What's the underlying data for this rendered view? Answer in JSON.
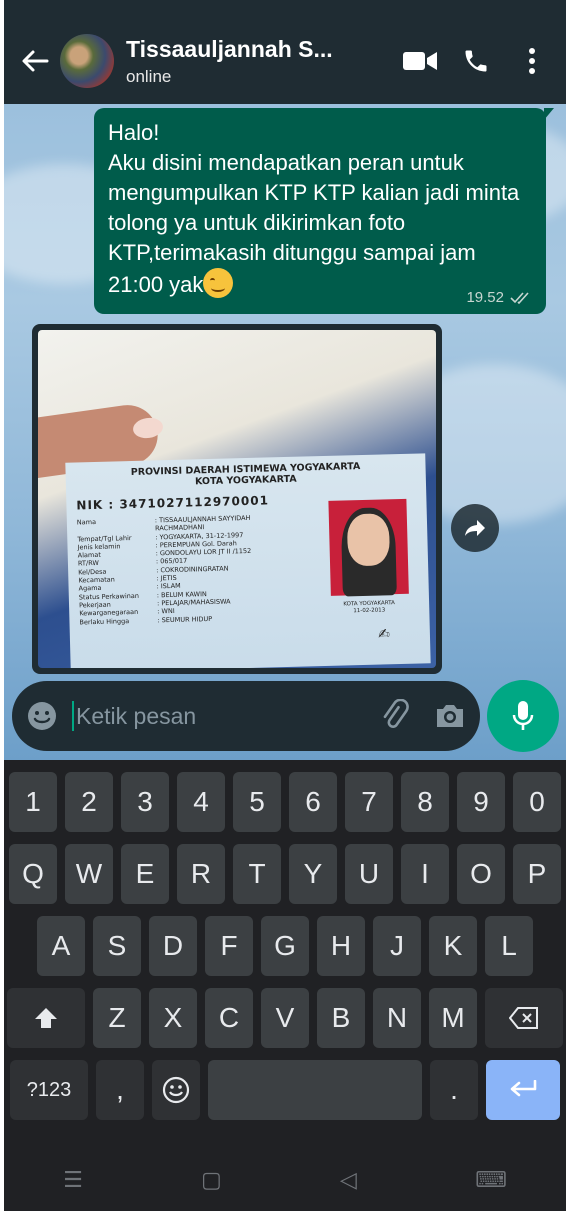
{
  "header": {
    "contact_name": "Tissaauljannah S...",
    "status": "online"
  },
  "messages": {
    "outgoing_text": "Halo!\nAku disini mendapatkan peran untuk mengumpulkan KTP KTP kalian jadi minta tolong ya untuk dikirimkan foto KTP,terimakasih ditunggu sampai jam 21:00 yak",
    "emoji": "smiling-face-with-smiling-eyes",
    "time": "19.52"
  },
  "ktp": {
    "province": "PROVINSI DAERAH ISTIMEWA YOGYAKARTA",
    "city": "KOTA YOGYAKARTA",
    "nik_label": "NIK",
    "nik_value": ": 3471027112970001",
    "rows": [
      {
        "k": "Nama",
        "v": ": TISSAAULJANNAH SAYYIDAH"
      },
      {
        "k": "",
        "v": "  RACHMADHANI"
      },
      {
        "k": "Tempat/Tgl Lahir",
        "v": ": YOGYAKARTA, 31-12-1997"
      },
      {
        "k": "Jenis kelamin",
        "v": ": PEREMPUAN   Gol. Darah"
      },
      {
        "k": "Alamat",
        "v": ": GONDOLAYU LOR JT II /1152"
      },
      {
        "k": "RT/RW",
        "v": ": 065/017"
      },
      {
        "k": "Kel/Desa",
        "v": ": COKRODININGRATAN"
      },
      {
        "k": "Kecamatan",
        "v": ": JETIS"
      },
      {
        "k": "Agama",
        "v": ": ISLAM"
      },
      {
        "k": "Status Perkawinan",
        "v": ": BELUM KAWIN"
      },
      {
        "k": "Pekerjaan",
        "v": ": PELAJAR/MAHASISWA"
      },
      {
        "k": "Kewarganegaraan",
        "v": ": WNI"
      },
      {
        "k": "Berlaku Hingga",
        "v": ": SEUMUR HIDUP"
      }
    ],
    "issue_city": "KOTA YOGYAKARTA",
    "issue_date": "11-02-2013"
  },
  "composer": {
    "placeholder": "Ketik pesan"
  },
  "keyboard": {
    "row_numbers": [
      "1",
      "2",
      "3",
      "4",
      "5",
      "6",
      "7",
      "8",
      "9",
      "0"
    ],
    "row_1": [
      "Q",
      "W",
      "E",
      "R",
      "T",
      "Y",
      "U",
      "I",
      "O",
      "P"
    ],
    "row_2": [
      "A",
      "S",
      "D",
      "F",
      "G",
      "H",
      "J",
      "K",
      "L"
    ],
    "row_3": [
      "Z",
      "X",
      "C",
      "V",
      "B",
      "N",
      "M"
    ],
    "symbols_label": "?123",
    "comma": ",",
    "period": "."
  },
  "colors": {
    "header_bg": "#1f2c33",
    "outgoing_bubble": "#005c4b",
    "accent": "#00a884",
    "keyboard_bg": "#202124",
    "enter_key": "#8ab4f8"
  }
}
